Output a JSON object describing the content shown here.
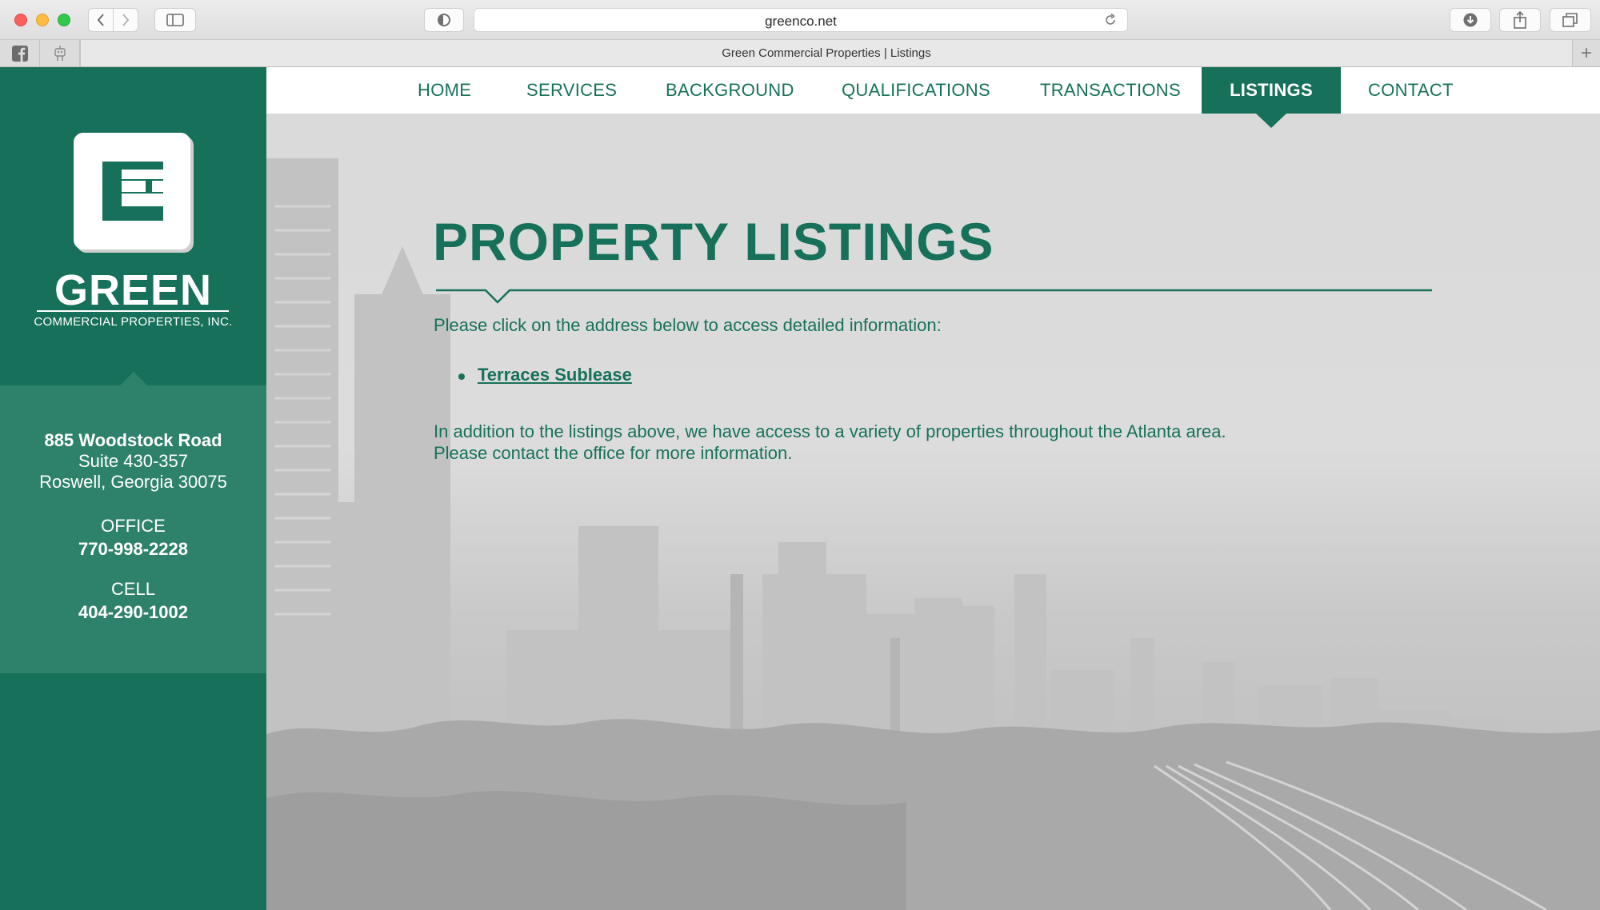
{
  "browser": {
    "url": "greenco.net",
    "tab_title": "Green Commercial Properties | Listings"
  },
  "nav": {
    "items": [
      "HOME",
      "SERVICES",
      "BACKGROUND",
      "QUALIFICATIONS",
      "TRANSACTIONS",
      "LISTINGS",
      "CONTACT"
    ],
    "active": "LISTINGS"
  },
  "brand": {
    "name": "GREEN",
    "subtitle": "COMMERCIAL PROPERTIES, INC.",
    "color": "#17715a"
  },
  "contact": {
    "street": "885 Woodstock Road",
    "suite": "Suite 430-357",
    "city": "Roswell, Georgia 30075",
    "office_label": "OFFICE",
    "office_phone": "770-998-2228",
    "cell_label": "CELL",
    "cell_phone": "404-290-1002"
  },
  "main": {
    "heading": "PROPERTY LISTINGS",
    "intro": "Please click on the address below to access detailed information:",
    "listings": [
      "Terraces Sublease"
    ],
    "paragraph_line1": "In addition to the listings above, we have access to a variety of properties throughout the Atlanta area.",
    "paragraph_line2": "Please contact the office for more information."
  }
}
